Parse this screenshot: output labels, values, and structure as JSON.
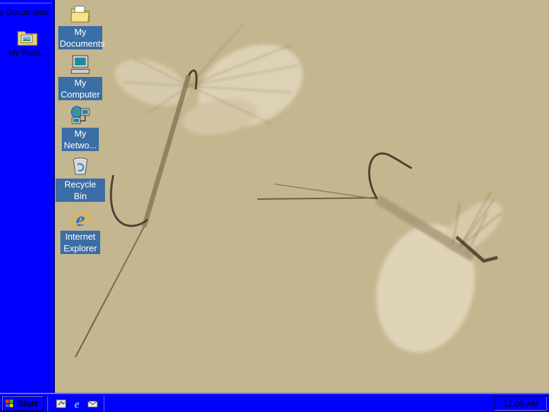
{
  "deskbar": {
    "documents_label": "s Documents",
    "pictures_label": "My Pictu..."
  },
  "desktop_icons": [
    {
      "label": "My Documents",
      "icon": "folder-icon"
    },
    {
      "label": "My Computer",
      "icon": "computer-icon"
    },
    {
      "label": "My Netwo...",
      "icon": "network-icon"
    },
    {
      "label": "Recycle Bin",
      "icon": "recycle-bin-icon"
    },
    {
      "label": "Internet Explorer",
      "icon": "ie-icon"
    }
  ],
  "taskbar": {
    "start_label": "Start",
    "clock": "12:00 AM"
  },
  "colors": {
    "desktop": "#c4b68e",
    "bar": "#0000ff",
    "label_highlight": "#3a6ea5"
  }
}
